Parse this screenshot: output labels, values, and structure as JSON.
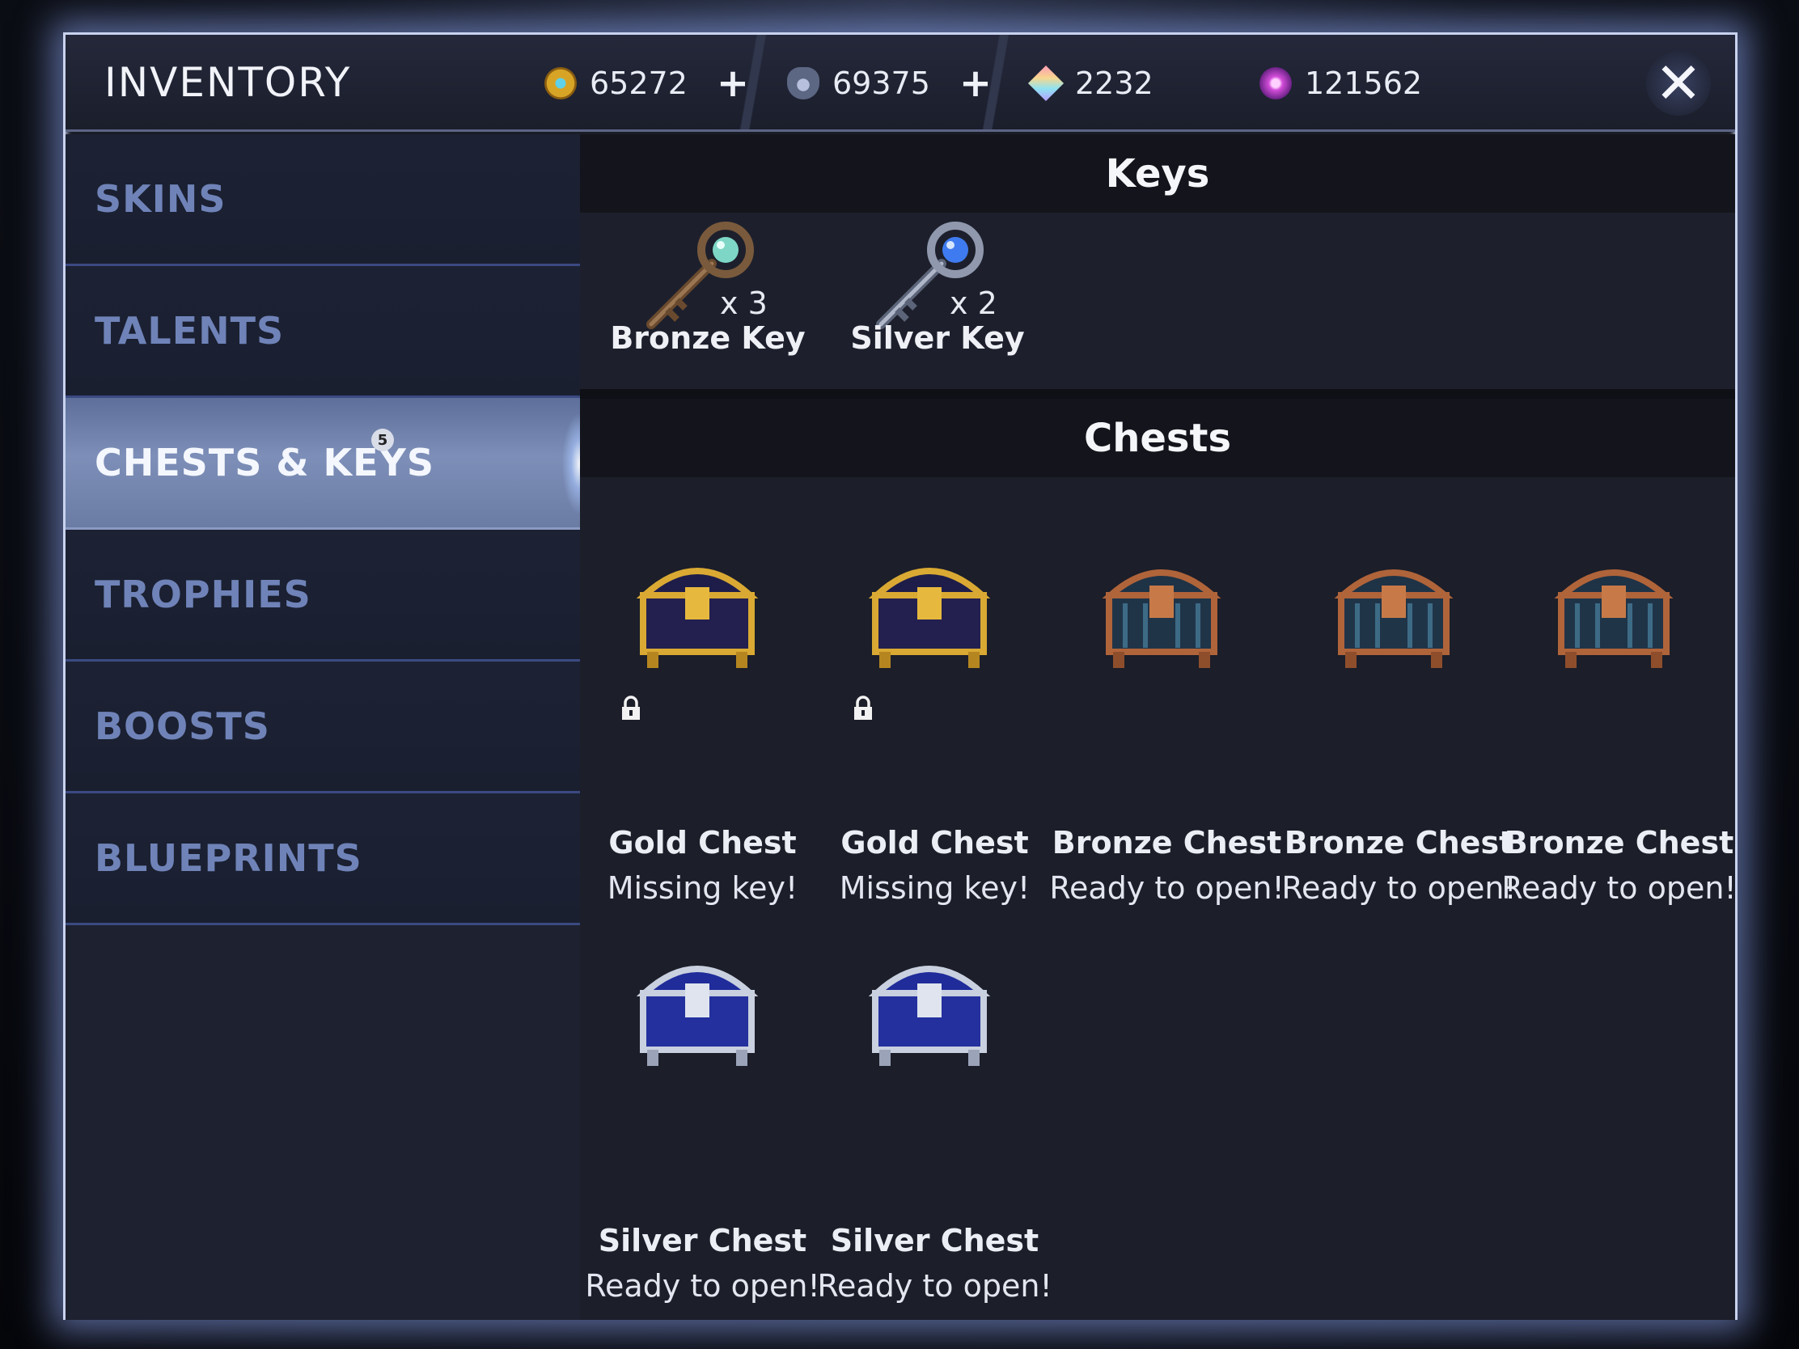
{
  "header": {
    "title": "INVENTORY",
    "currencies": [
      {
        "icon": "gold-coin-icon",
        "value": "65272",
        "has_plus": true
      },
      {
        "icon": "glory-shield-icon",
        "value": "69375",
        "has_plus": true
      },
      {
        "icon": "ice-gem-icon",
        "value": "2232",
        "has_plus": false
      },
      {
        "icon": "essence-icon",
        "value": "121562",
        "has_plus": false
      }
    ],
    "plus_label": "+",
    "close_label": "✕"
  },
  "sidebar": {
    "items": [
      {
        "label": "SKINS",
        "active": false
      },
      {
        "label": "TALENTS",
        "active": false
      },
      {
        "label": "CHESTS & KEYS",
        "active": true,
        "badge": "5"
      },
      {
        "label": "TROPHIES",
        "active": false
      },
      {
        "label": "BOOSTS",
        "active": false
      },
      {
        "label": "BLUEPRINTS",
        "active": false
      }
    ]
  },
  "keys_section": {
    "title": "Keys",
    "items": [
      {
        "name": "Bronze Key",
        "qty": "x 3",
        "icon": "bronze-key-icon"
      },
      {
        "name": "Silver Key",
        "qty": "x 2",
        "icon": "silver-key-icon"
      }
    ]
  },
  "chests_section": {
    "title": "Chests",
    "items": [
      {
        "name": "Gold Chest",
        "status": "Missing key!",
        "locked": true,
        "tier": "gold"
      },
      {
        "name": "Gold Chest",
        "status": "Missing key!",
        "locked": true,
        "tier": "gold"
      },
      {
        "name": "Bronze Chest",
        "status": "Ready to open!",
        "locked": false,
        "tier": "bronze"
      },
      {
        "name": "Bronze Chest",
        "status": "Ready to open!",
        "locked": false,
        "tier": "bronze"
      },
      {
        "name": "Bronze Chest",
        "status": "Ready to open!",
        "locked": false,
        "tier": "bronze"
      },
      {
        "name": "Silver Chest",
        "status": "Ready to open!",
        "locked": false,
        "tier": "silver"
      },
      {
        "name": "Silver Chest",
        "status": "Ready to open!",
        "locked": false,
        "tier": "silver"
      }
    ]
  },
  "colors": {
    "modal_border": "#c9d3ef",
    "sidebar_text": "#6f83b8",
    "active_tab": "#6b7ca4",
    "gold": "#d8a426",
    "bronze": "#b0643a",
    "silver": "#c9d0df"
  }
}
